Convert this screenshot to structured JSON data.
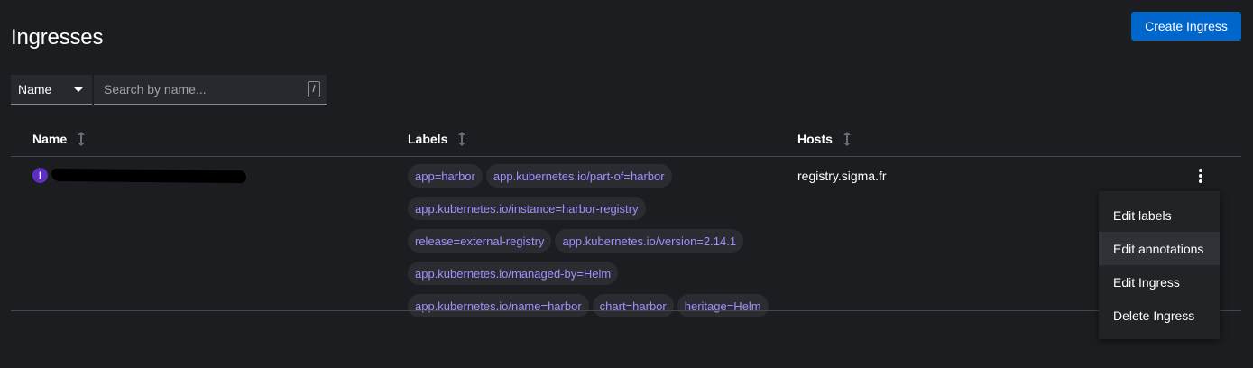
{
  "page": {
    "title": "Ingresses",
    "create_button": "Create Ingress"
  },
  "filter": {
    "selected": "Name",
    "search_placeholder": "Search by name...",
    "shortcut_hint": "/"
  },
  "table": {
    "columns": [
      "Name",
      "Labels",
      "Hosts"
    ],
    "rows": [
      {
        "badge": "I",
        "name_redacted": true,
        "labels": [
          "app=harbor",
          "app.kubernetes.io/part-of=harbor",
          "app.kubernetes.io/instance=harbor-registry",
          "release=external-registry",
          "app.kubernetes.io/version=2.14.1",
          "app.kubernetes.io/managed-by=Helm",
          "app.kubernetes.io/name=harbor",
          "chart=harbor",
          "heritage=Helm"
        ],
        "host": "registry.sigma.fr"
      }
    ]
  },
  "row_menu": {
    "items": [
      "Edit labels",
      "Edit annotations",
      "Edit Ingress",
      "Delete Ingress"
    ],
    "hovered": "Edit annotations"
  },
  "colors": {
    "background": "#1b1d21",
    "primary_button": "#0066cc",
    "label_text": "#a18fff",
    "badge": "#5a2fc2"
  }
}
